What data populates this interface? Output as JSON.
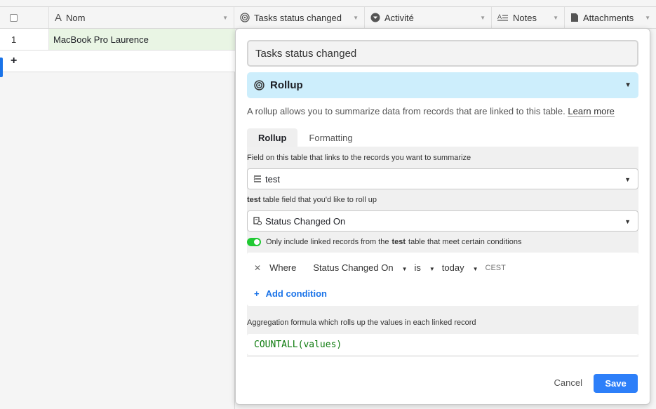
{
  "columns": {
    "nom": "Nom",
    "tasks_status": "Tasks status changed",
    "activite": "Activité",
    "notes": "Notes",
    "attachments": "Attachments"
  },
  "rows": [
    {
      "number": "1",
      "name": "MacBook Pro Laurence"
    }
  ],
  "add_row_symbol": "+",
  "panel": {
    "field_name": "Tasks status changed",
    "field_type": "Rollup",
    "description": "A rollup allows you to summarize data from records that are linked to this table.",
    "learn_more": "Learn more",
    "tabs": [
      "Rollup",
      "Formatting"
    ],
    "link_field_label": "Field on this table that links to the records you want to summarize",
    "link_field_value": "test",
    "rollup_field_label_table": "test",
    "rollup_field_label_rest": "table field that you'd like to roll up",
    "rollup_field_value": "Status Changed On",
    "toggle_text_before": "Only include linked records from the",
    "toggle_text_table": "test",
    "toggle_text_after": "table that meet certain conditions",
    "condition": {
      "where": "Where",
      "field": "Status Changed On",
      "operator": "is",
      "value": "today",
      "timezone": "CEST"
    },
    "add_condition": "Add condition",
    "aggregation_label": "Aggregation formula which rolls up the values in each linked record",
    "formula": "COUNTALL(values)",
    "cancel": "Cancel",
    "save": "Save"
  },
  "colors": {
    "accent": "#2d7ff9",
    "type_bg": "#cdeefc",
    "toggle": "#20c933",
    "formula": "#0b7a0b"
  }
}
